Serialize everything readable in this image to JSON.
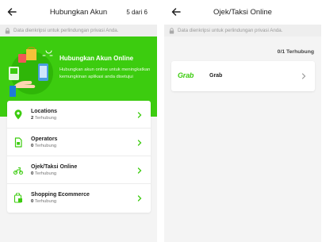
{
  "left": {
    "title": "Hubungkan Akun",
    "step": "5 dari 6",
    "privacy_note": "Data dienkripsi untuk perlindungan privasi Anda.",
    "banner": {
      "title": "Hubungkan Akun Online",
      "description": "Hubungkan akun online untuk meningkatkan kemungkinan aplikasi anda disetujui"
    },
    "items": [
      {
        "title": "Locations",
        "count": "2",
        "suffix": "Terhubung",
        "icon": "location-pin-icon"
      },
      {
        "title": "Operators",
        "count": "0",
        "suffix": "Terhubung",
        "icon": "sim-card-icon"
      },
      {
        "title": "Ojek/Taksi Online",
        "count": "0",
        "suffix": "Terhubung",
        "icon": "motorbike-icon"
      },
      {
        "title": "Shopping Ecommerce",
        "count": "0",
        "suffix": "Terhubung",
        "icon": "shopping-icon"
      }
    ]
  },
  "right": {
    "title": "Ojek/Taksi Online",
    "privacy_note": "Data dienkripsi untuk perlindungan privasi Anda.",
    "connected_count": "0/1 Terhubung",
    "provider": {
      "logo_text": "Grab",
      "name": "Grab"
    }
  },
  "colors": {
    "accent": "#3ccc0f",
    "background": "#f4f4f4"
  }
}
